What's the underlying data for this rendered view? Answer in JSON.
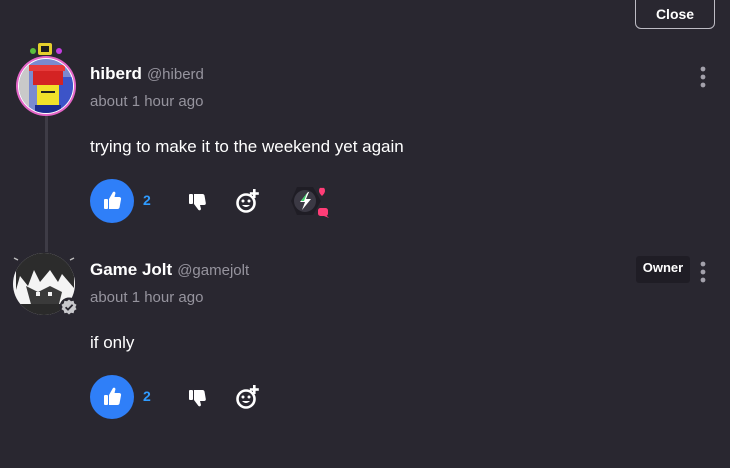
{
  "header": {
    "close_label": "Close"
  },
  "comments": [
    {
      "author_name": "hiberd",
      "author_handle": "@hiberd",
      "timestamp": "about 1 hour ago",
      "body": "trying to make it to the weekend yet again",
      "like_count": "2",
      "avatar_ring_color": "#e466c8",
      "has_sticker": true
    },
    {
      "author_name": "Game Jolt",
      "author_handle": "@gamejolt",
      "timestamp": "about 1 hour ago",
      "body": "if only",
      "like_count": "2",
      "badge": "Owner",
      "verified": true
    }
  ],
  "colors": {
    "background": "#292730",
    "like_blue": "#2f7ff8",
    "like_count_blue": "#2f9bff",
    "muted_text": "#96949e",
    "heart_pink": "#ff3d77"
  },
  "icons": [
    "thumbs-up-icon",
    "thumbs-down-icon",
    "add-reaction-icon",
    "more-vertical-icon",
    "verified-check-icon",
    "bolt-sticker-icon",
    "heart-icon",
    "chat-bubble-icon"
  ]
}
